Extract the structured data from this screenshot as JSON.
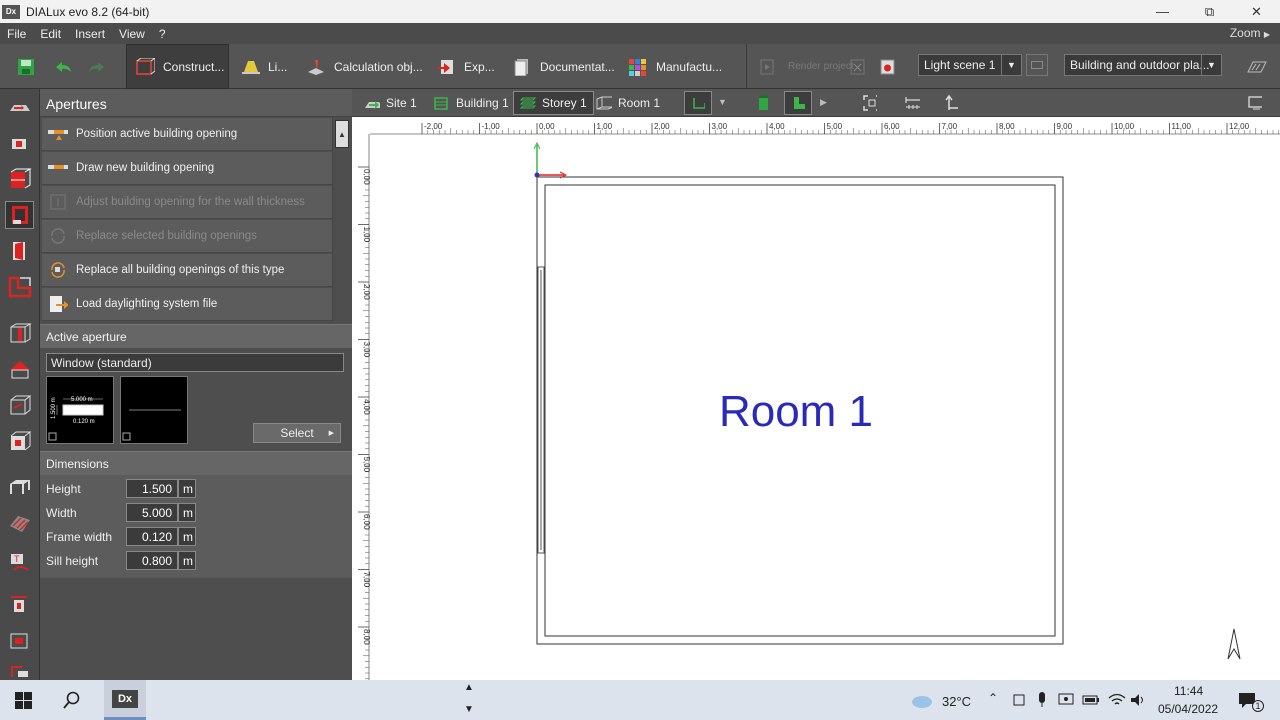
{
  "window": {
    "title": "DIALux evo 8.2  (64-bit)",
    "logo": "Dx",
    "minimize_icon": "minimize-icon",
    "restore_icon": "restore-icon",
    "close_icon": "close-icon"
  },
  "menu": {
    "items": [
      "File",
      "Edit",
      "Insert",
      "View",
      "?"
    ],
    "zoom": "Zoom"
  },
  "toolbar": {
    "tabs": [
      {
        "label": "Construct...",
        "icon": "construction-icon"
      },
      {
        "label": "Li...",
        "icon": "light-icon"
      },
      {
        "label": "Calculation obj...",
        "icon": "calculation-objects-icon"
      },
      {
        "label": "Exp...",
        "icon": "export-icon"
      },
      {
        "label": "Documentat...",
        "icon": "documentation-icon"
      },
      {
        "label": "Manufactu...",
        "icon": "manufacturers-icon"
      }
    ],
    "render_label": "Render project",
    "light_scene": "Light scene 1",
    "view_mode": "Building and outdoor pla...",
    "accent": "#3cb54a"
  },
  "panel": {
    "title": "Apertures",
    "actions": [
      {
        "label": "Position active building opening",
        "enabled": true
      },
      {
        "label": "Draw new building opening",
        "enabled": true
      },
      {
        "label": "Adjust building opening for the wall thickness",
        "enabled": false
      },
      {
        "label": "Replace selected building openings",
        "enabled": false
      },
      {
        "label": "Replace all building openings of this type",
        "enabled": true
      },
      {
        "label": "Load daylighting system file",
        "enabled": true
      }
    ],
    "active_aperture": {
      "title": "Active aperture",
      "type": "Window (standard)",
      "preview": {
        "width": "5.000 m",
        "height": "1.500 m",
        "frame": "0.120 m"
      },
      "select_label": "Select"
    },
    "dimensions": {
      "title": "Dimensions",
      "fields": [
        {
          "label": "Height",
          "value": "1.500",
          "unit": "m"
        },
        {
          "label": "Width",
          "value": "5.000",
          "unit": "m"
        },
        {
          "label": "Frame width",
          "value": "0.120",
          "unit": "m"
        },
        {
          "label": "Sill height",
          "value": "0.800",
          "unit": "m"
        }
      ]
    }
  },
  "navbar": {
    "crumbs": [
      "Site 1",
      "Building 1",
      "Storey 1",
      "Room 1"
    ],
    "selected": "Storey 1"
  },
  "canvas": {
    "room_label": "Room 1",
    "room_label_color": "#2a2ab8",
    "ruler_x": [
      "-2,00",
      "-1,00",
      "0,00",
      "1,00",
      "2,00",
      "3,00",
      "4,00",
      "5,00",
      "6,00",
      "7,00",
      "8,00",
      "9,00",
      "10,00",
      "11,00",
      "12,00"
    ],
    "ruler_y": [
      "0,00",
      "1,00",
      "2,00",
      "3,00",
      "4,00",
      "5,00",
      "6,00",
      "7,00",
      "8,00"
    ]
  },
  "taskbar": {
    "temperature": "32°C",
    "time": "11:44",
    "date": "05/04/2022",
    "app": "Dx",
    "notifications": "1"
  }
}
